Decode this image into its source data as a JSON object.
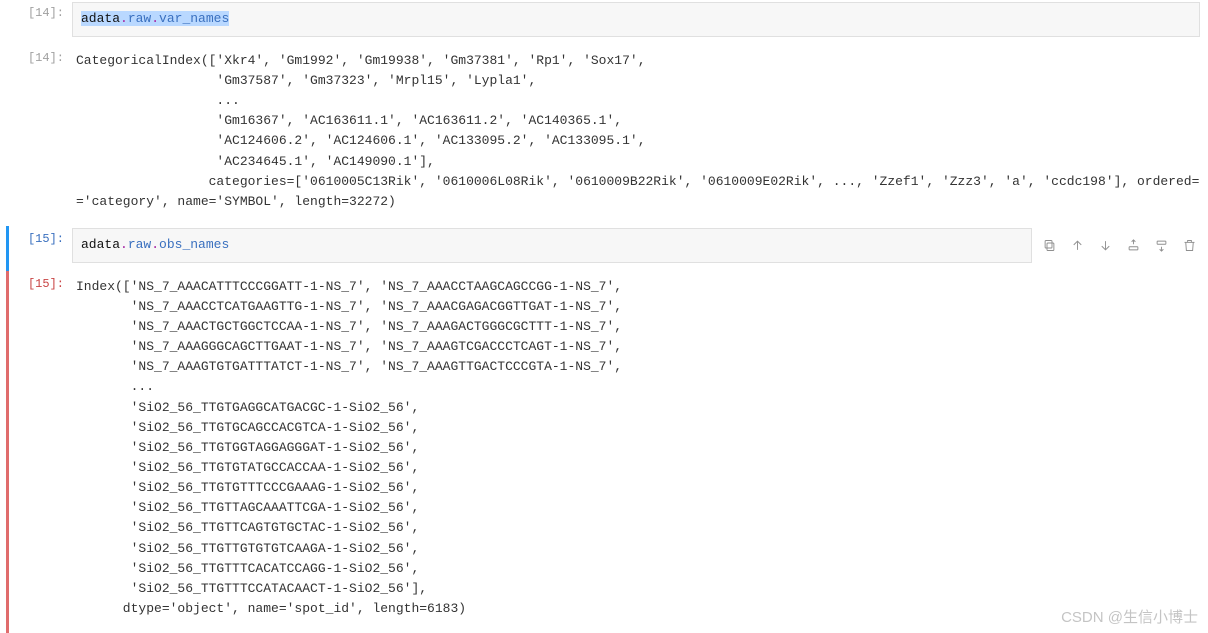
{
  "cells": {
    "cell0": {
      "prompt": "[14]:",
      "code_tokens": {
        "a": "adata",
        "b": ".",
        "c": "raw",
        "d": ".",
        "e": "var_names"
      }
    },
    "out0": {
      "prompt": "[14]:",
      "text": "CategoricalIndex(['Xkr4', 'Gm1992', 'Gm19938', 'Gm37381', 'Rp1', 'Sox17',\n                  'Gm37587', 'Gm37323', 'Mrpl15', 'Lypla1',\n                  ...\n                  'Gm16367', 'AC163611.1', 'AC163611.2', 'AC140365.1',\n                  'AC124606.2', 'AC124606.1', 'AC133095.2', 'AC133095.1',\n                  'AC234645.1', 'AC149090.1'],\n                 categories=['0610005C13Rik', '0610006L08Rik', '0610009B22Rik', '0610009E02Rik', ..., 'Zzef1', 'Zzz3', 'a', 'ccdc198'], ordered=False, dtype\n='category', name='SYMBOL', length=32272)"
    },
    "cell1": {
      "prompt": "[15]:",
      "code_tokens": {
        "a": "adata",
        "b": ".",
        "c": "raw",
        "d": ".",
        "e": "obs_names"
      }
    },
    "out1": {
      "prompt": "[15]:",
      "text": "Index(['NS_7_AAACATTTCCCGGATT-1-NS_7', 'NS_7_AAACCTAAGCAGCCGG-1-NS_7',\n       'NS_7_AAACCTCATGAAGTTG-1-NS_7', 'NS_7_AAACGAGACGGTTGAT-1-NS_7',\n       'NS_7_AAACTGCTGGCTCCAA-1-NS_7', 'NS_7_AAAGACTGGGCGCTTT-1-NS_7',\n       'NS_7_AAAGGGCAGCTTGAAT-1-NS_7', 'NS_7_AAAGTCGACCCTCAGT-1-NS_7',\n       'NS_7_AAAGTGTGATTTATCT-1-NS_7', 'NS_7_AAAGTTGACTCCCGTA-1-NS_7',\n       ...\n       'SiO2_56_TTGTGAGGCATGACGC-1-SiO2_56',\n       'SiO2_56_TTGTGCAGCCACGTCA-1-SiO2_56',\n       'SiO2_56_TTGTGGTAGGAGGGAT-1-SiO2_56',\n       'SiO2_56_TTGTGTATGCCACCAA-1-SiO2_56',\n       'SiO2_56_TTGTGTTTCCCGAAAG-1-SiO2_56',\n       'SiO2_56_TTGTTAGCAAATTCGA-1-SiO2_56',\n       'SiO2_56_TTGTTCAGTGTGCTAC-1-SiO2_56',\n       'SiO2_56_TTGTTGTGTGTCAAGA-1-SiO2_56',\n       'SiO2_56_TTGTTTCACATCCAGG-1-SiO2_56',\n       'SiO2_56_TTGTTTCCATACAACT-1-SiO2_56'],\n      dtype='object', name='spot_id', length=6183)"
    }
  },
  "toolbar": {
    "copy": "Copy cell",
    "up": "Move up",
    "down": "Move down",
    "insert_above": "Insert above",
    "insert_below": "Insert below",
    "delete": "Delete cell"
  },
  "watermark": "CSDN @生信小博士"
}
